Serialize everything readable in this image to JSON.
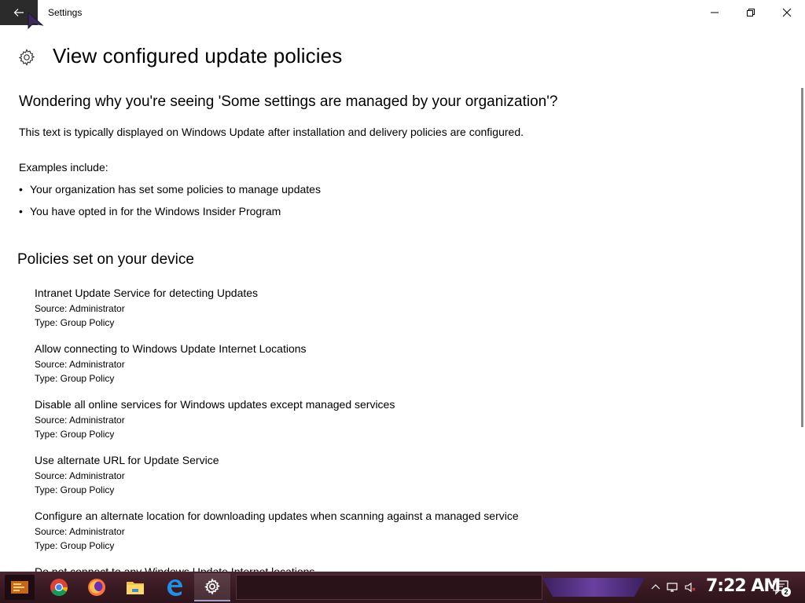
{
  "window": {
    "app_title": "Settings",
    "back_icon": "back-arrow-icon",
    "controls": [
      "minimize-icon",
      "maximize-icon",
      "close-icon"
    ]
  },
  "header": {
    "icon": "gear-icon",
    "title": "View configured update policies"
  },
  "intro": {
    "heading": "Wondering why you're seeing 'Some settings are managed by your organization'?",
    "description": "This text is typically displayed on Windows Update after installation and delivery policies are configured.",
    "examples_label": "Examples include:",
    "examples": [
      "Your organization has set some policies to manage updates",
      "You have opted in for the Windows Insider Program"
    ]
  },
  "policies": {
    "heading": "Policies set on your device",
    "items": [
      {
        "name": "Intranet Update Service for detecting Updates",
        "source": "Source: Administrator",
        "type": "Type: Group Policy"
      },
      {
        "name": "Allow connecting to Windows Update Internet Locations",
        "source": "Source: Administrator",
        "type": "Type: Group Policy"
      },
      {
        "name": "Disable all online services for Windows updates except managed services",
        "source": "Source: Administrator",
        "type": "Type: Group Policy"
      },
      {
        "name": "Use alternate URL for Update Service",
        "source": "Source: Administrator",
        "type": "Type: Group Policy"
      },
      {
        "name": "Configure an alternate location for downloading updates when scanning against a managed service",
        "source": "Source: Administrator",
        "type": "Type: Group Policy"
      },
      {
        "name": "Do not connect to any Windows Update Internet locations"
      }
    ]
  },
  "taskbar": {
    "apps": [
      "start-icon",
      "chrome-icon",
      "firefox-icon",
      "file-explorer-icon",
      "edge-icon",
      "settings-icon"
    ],
    "tray": [
      "chevron-up-icon",
      "network-icon",
      "volume-muted-icon"
    ],
    "clock": "7:22 AM",
    "notification_count": "2"
  }
}
